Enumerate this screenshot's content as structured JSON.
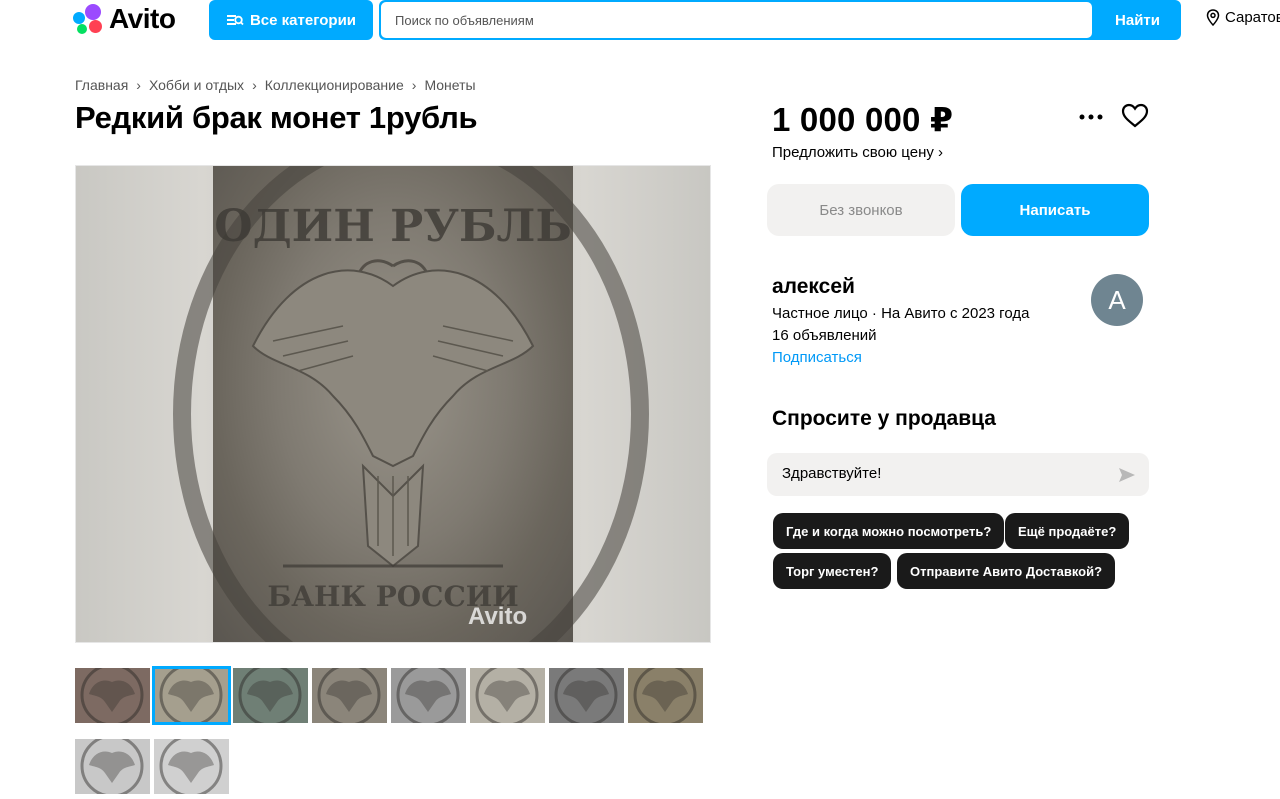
{
  "header": {
    "logo_text": "Avito",
    "categories_label": "Все категории",
    "search_placeholder": "Поиск по объявлениям",
    "search_button": "Найти",
    "location": "Саратов"
  },
  "breadcrumbs": [
    "Главная",
    "Хобби и отдых",
    "Коллекционирование",
    "Монеты"
  ],
  "listing": {
    "title": "Редкий брак монет 1рубль",
    "price": "1 000 000 ₽",
    "offer_price": "Предложить свою цену",
    "photo_watermark": "Avito",
    "thumbnail_count": 10,
    "active_thumbnail": 2
  },
  "actions": {
    "no_calls": "Без звонков",
    "write": "Написать"
  },
  "seller": {
    "name": "алексей",
    "meta": "Частное лицо · На Авито с 2023 года",
    "ads": "16 объявлений",
    "subscribe": "Подписаться",
    "avatar_letter": "А"
  },
  "ask": {
    "title": "Спросите у продавца",
    "message": "Здравствуйте!",
    "quick_questions": [
      "Где и когда можно посмотреть?",
      "Ещё продаёте?",
      "Торг уместен?",
      "Отправите Авито Доставкой?"
    ]
  },
  "colors": {
    "accent": "#00aaff",
    "chip_bg": "#1a1a1a",
    "link": "#0099f7",
    "avatar_bg": "#6f8591"
  }
}
